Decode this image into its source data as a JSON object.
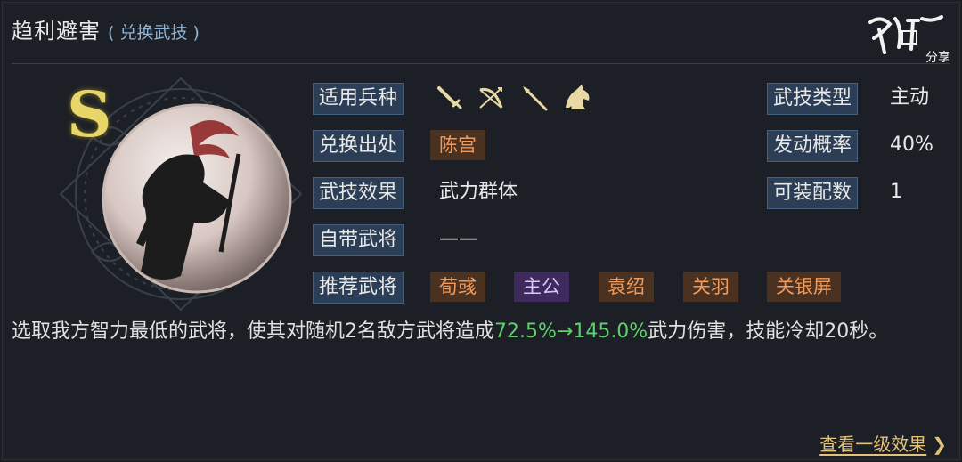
{
  "header": {
    "title": "趋利避害",
    "subtitle": "( 兑换武技 )"
  },
  "logo_text": "鸿图评 分享",
  "grade": "S",
  "rows": {
    "troop": {
      "label": "适用兵种",
      "icons": [
        "sword-icon",
        "bow-icon",
        "spear-icon",
        "horse-icon"
      ]
    },
    "source": {
      "label": "兑换出处",
      "tag": "陈宫"
    },
    "effect": {
      "label": "武技效果",
      "value": "武力群体"
    },
    "own_general": {
      "label": "自带武将",
      "value": "——"
    },
    "recommend": {
      "label": "推荐武将",
      "tags": [
        "荀彧",
        "主公",
        "袁绍",
        "关羽",
        "关银屏"
      ]
    },
    "skill_type": {
      "label": "武技类型",
      "value": "主动"
    },
    "trigger_rate": {
      "label": "发动概率",
      "value": "40%"
    },
    "equip_count": {
      "label": "可装配数",
      "value": "1"
    }
  },
  "description": {
    "prefix": "选取我方智力最低的武将，使其对随机2名敌方武将造成",
    "highlight": "72.5%→145.0%",
    "suffix": "武力伤害，技能冷却20秒。"
  },
  "link": {
    "label": "查看一级效果",
    "chevron": "❯"
  },
  "colors": {
    "accent_gold": "#e2c27a",
    "highlight_green": "#5fd06a",
    "label_bg": "#2c3e55"
  }
}
